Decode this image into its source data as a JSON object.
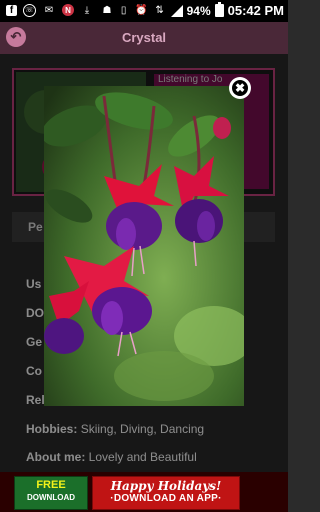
{
  "status_bar": {
    "battery": "94%",
    "time": "05:42 PM"
  },
  "app_bar": {
    "title": "Crystal"
  },
  "profile": {
    "listening": "Listening to Jo",
    "section_title": "Pe",
    "rows": [
      {
        "label": "Us",
        "value": ""
      },
      {
        "label": "DO",
        "value": ""
      },
      {
        "label": "Ge",
        "value": ""
      },
      {
        "label": "Co",
        "value": ""
      },
      {
        "label": "Rel",
        "value": ""
      },
      {
        "label": "Hobbies:",
        "value": "Skiing, Diving, Dancing"
      },
      {
        "label": "About me:",
        "value": "Lovely and Beautiful"
      }
    ]
  },
  "ad": {
    "free_label": "FREE",
    "download_label": "DOWNLOAD",
    "headline": "Happy Holidays!",
    "cta": "·DOWNLOAD AN APP·"
  },
  "colors": {
    "app_bar": "#4a2838",
    "accent": "#c0407a",
    "background": "#2b2b2b"
  }
}
